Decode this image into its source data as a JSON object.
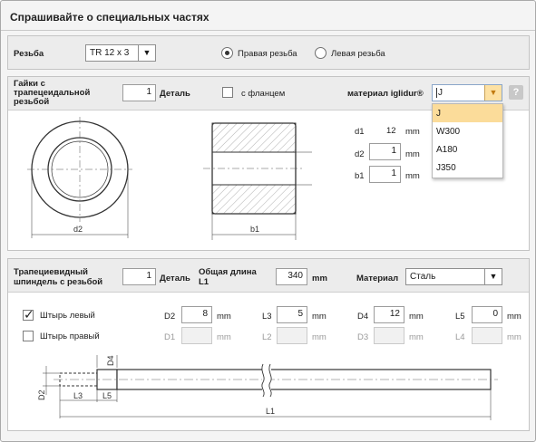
{
  "title": "Спрашивайте о специальных частях",
  "thread": {
    "label": "Резьба",
    "value": "TR 12 x 3",
    "right_label": "Правая резьба",
    "left_label": "Левая резьба",
    "selected": "right"
  },
  "nut": {
    "label": "Гайки с трапецеидальной резьбой",
    "qty": "1",
    "qty_unit": "Деталь",
    "flange_label": "с фланцем",
    "flange_checked": false,
    "material_label": "материал iglidur®",
    "material_value": "J",
    "help": "?",
    "material_options": [
      "J",
      "W300",
      "A180",
      "J350"
    ],
    "dims": [
      {
        "label": "d1",
        "value": "12",
        "unit": "mm",
        "editable": false
      },
      {
        "label": "d2",
        "value": "1",
        "unit": "mm",
        "editable": true
      },
      {
        "label": "b1",
        "value": "1",
        "unit": "mm",
        "editable": true
      }
    ],
    "drawing": {
      "d2": "d2",
      "d1": "d1",
      "b1": "b1"
    }
  },
  "spindle": {
    "label": "Трапециевидный шпиндель с резьбой",
    "qty": "1",
    "qty_unit": "Деталь",
    "length_label": "Общая длина L1",
    "length_value": "340",
    "length_unit": "mm",
    "material_label": "Материал",
    "material_value": "Сталь",
    "pin_left": {
      "label": "Штырь левый",
      "checked": true,
      "fields": [
        {
          "label": "D2",
          "value": "8",
          "unit": "mm"
        },
        {
          "label": "L3",
          "value": "5",
          "unit": "mm"
        },
        {
          "label": "D4",
          "value": "12",
          "unit": "mm"
        },
        {
          "label": "L5",
          "value": "0",
          "unit": "mm"
        }
      ]
    },
    "pin_right": {
      "label": "Штырь правый",
      "checked": false,
      "fields": [
        {
          "label": "D1",
          "value": "",
          "unit": "mm"
        },
        {
          "label": "L2",
          "value": "",
          "unit": "mm"
        },
        {
          "label": "D3",
          "value": "",
          "unit": "mm"
        },
        {
          "label": "L4",
          "value": "",
          "unit": "mm"
        }
      ]
    },
    "drawing": {
      "D4": "D4",
      "D2": "D2",
      "L3": "L3",
      "L5": "L5",
      "L1": "L1"
    }
  }
}
